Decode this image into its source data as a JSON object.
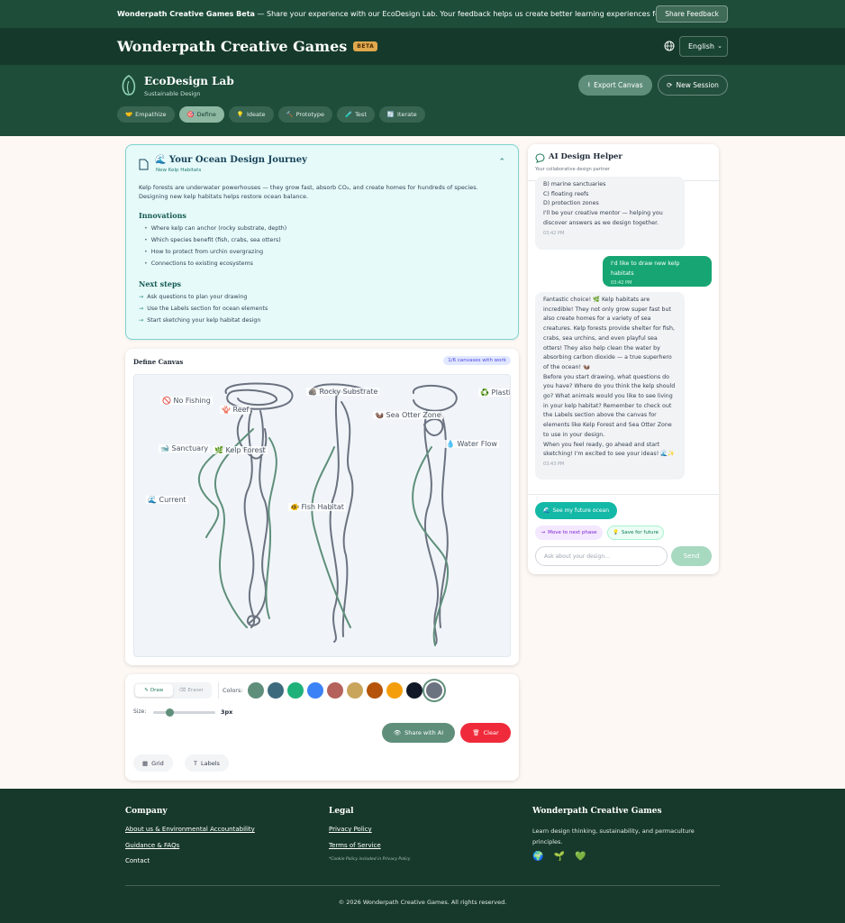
{
  "banner": {
    "bold": "Wonderpath Creative Games Beta",
    "text": " — Share your experience with our EcoDesign Lab. Your feedback helps us create better learning experiences for everyone.",
    "button": "Share Feedback"
  },
  "header": {
    "brand": "Wonderpath Creative Games",
    "badge": "BETA",
    "language": "English"
  },
  "lab": {
    "title": "EcoDesign Lab",
    "subtitle": "Sustainable Design",
    "export_label": "Export Canvas",
    "new_session_label": "New Session",
    "phases": [
      {
        "emoji": "🤝",
        "label": "Empathize"
      },
      {
        "emoji": "🎯",
        "label": "Define"
      },
      {
        "emoji": "💡",
        "label": "Ideate"
      },
      {
        "emoji": "🔨",
        "label": "Prototype"
      },
      {
        "emoji": "🧪",
        "label": "Test"
      },
      {
        "emoji": "🔄",
        "label": "Iterate"
      }
    ]
  },
  "journey": {
    "title": "🌊 Your Ocean Design Journey",
    "subtitle": "New Kelp Habitats",
    "body": "Kelp forests are underwater powerhouses — they grow fast, absorb CO₂, and create homes for hundreds of species. Designing new kelp habitats helps restore ocean balance.",
    "innovations_heading": "Innovations",
    "innovations": [
      "Where kelp can anchor (rocky substrate, depth)",
      "Which species benefit (fish, crabs, sea otters)",
      "How to protect from urchin overgrazing",
      "Connections to existing ecosystems"
    ],
    "next_heading": "Next steps",
    "next_steps": [
      "Ask questions to plan your drawing",
      "Use the Labels section for ocean elements",
      "Start sketching your kelp habitat design"
    ]
  },
  "canvas": {
    "title": "Define Canvas",
    "badge": "1/6 canvases with work",
    "labels": [
      "🚫 No Fishing",
      "🪸 Reef",
      "🪨 Rocky Substrate",
      "♻️ Plastic",
      "🦦 Sea Otter Zone",
      "🐋 Sanctuary",
      "🌿 Kelp Forest",
      "💧 Water Flow",
      "🌊 Current",
      "🐠 Fish Habitat"
    ]
  },
  "tools": {
    "draw": "Draw",
    "eraser": "Eraser",
    "colors_label": "Colors:",
    "colors": [
      "#5f8f7b",
      "#3d6b7d",
      "#1fb17a",
      "#3b82f6",
      "#b5615c",
      "#c9a55c",
      "#b45309",
      "#f59e0b",
      "#111827",
      "#6b7280"
    ],
    "size_label": "Size:",
    "size_value": "3px",
    "share_ai": "Share with AI",
    "clear": "Clear",
    "grid": "Grid",
    "labels": "Labels"
  },
  "ai": {
    "title": "AI Design Helper",
    "subtitle": "Your collaborative design partner",
    "messages": [
      {
        "role": "bot",
        "lines": [
          "B) marine sanctuaries",
          "C) floating reefs",
          "D) protection zones",
          "I'll be your creative mentor — helping you discover answers as we design together."
        ],
        "time": "03:42 PM"
      },
      {
        "role": "user",
        "lines": [
          "I'd like to draw new kelp habitats"
        ],
        "time": "03:42 PM"
      },
      {
        "role": "bot",
        "lines": [
          "Fantastic choice! 🌿 Kelp habitats are incredible! They not only grow super fast but also create homes for a variety of sea creatures. Kelp forests provide shelter for fish, crabs, sea urchins, and even playful sea otters! They also help clean the water by absorbing carbon dioxide — a true superhero of the ocean! 🦦",
          "Before you start drawing, what questions do you have? Where do you think the kelp should go? What animals would you like to see living in your kelp habitat? Remember to check out the Labels section above the canvas for elements like Kelp Forest and Sea Otter Zone to use in your design.",
          "When you feel ready, go ahead and start sketching! I'm excited to see your ideas! 🌊✨"
        ],
        "time": "03:43 PM"
      }
    ],
    "future_btn": "See my future ocean",
    "next_phase": "Move to next phase",
    "save_future": "Save for future",
    "placeholder": "Ask about your design...",
    "send": "Send"
  },
  "footer": {
    "company_heading": "Company",
    "company_links": [
      "About us & Environmental Accountability",
      "Guidance & FAQs",
      "Contact"
    ],
    "legal_heading": "Legal",
    "legal_links": [
      "Privacy Policy",
      "Terms of Service"
    ],
    "legal_note": "*Cookie Policy included in Privacy Policy",
    "brand_heading": "Wonderpath Creative Games",
    "brand_desc": "Learn design thinking, sustainability, and permaculture principles.",
    "emojis": "🌍 🌱 💚",
    "copyright": "© 2026 Wonderpath Creative Games. All rights reserved."
  }
}
